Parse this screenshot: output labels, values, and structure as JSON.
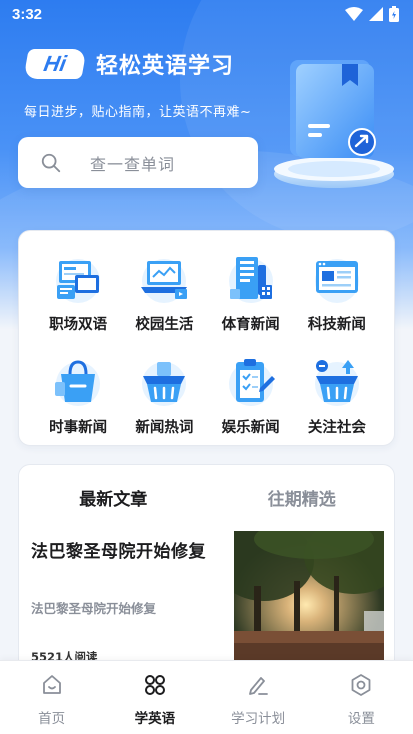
{
  "status_bar": {
    "time": "3:32"
  },
  "brand": {
    "logo_text": "Hi",
    "title": "轻松英语学习"
  },
  "slogan": "每日进步，贴心指南，让英语不再难~",
  "search": {
    "placeholder": "查一查单词"
  },
  "categories": [
    {
      "label": "职场双语",
      "icon": "workplace-screens-icon"
    },
    {
      "label": "校园生活",
      "icon": "campus-laptop-icon"
    },
    {
      "label": "体育新闻",
      "icon": "sports-news-building-icon"
    },
    {
      "label": "科技新闻",
      "icon": "tech-news-browser-icon"
    },
    {
      "label": "时事新闻",
      "icon": "shopping-bag-icon"
    },
    {
      "label": "新闻热词",
      "icon": "basket-icon"
    },
    {
      "label": "娱乐新闻",
      "icon": "clipboard-icon"
    },
    {
      "label": "关注社会",
      "icon": "basket-plus-icon"
    }
  ],
  "articles": {
    "tabs": [
      {
        "label": "最新文章",
        "active": true
      },
      {
        "label": "往期精选",
        "active": false
      }
    ],
    "items": [
      {
        "title": "法巴黎圣母院开始修复",
        "subtitle": "法巴黎圣母院开始修复",
        "reads": "5521人阅读"
      }
    ]
  },
  "nav": [
    {
      "label": "首页",
      "icon": "home-icon",
      "active": false
    },
    {
      "label": "学英语",
      "icon": "grid-icon",
      "active": true
    },
    {
      "label": "学习计划",
      "icon": "edit-plan-icon",
      "active": false
    },
    {
      "label": "设置",
      "icon": "settings-icon",
      "active": false
    }
  ],
  "colors": {
    "primary": "#2d7cf0",
    "accent": "#3aa0f5",
    "text": "#1d1d1f",
    "muted": "#8a8f99"
  }
}
